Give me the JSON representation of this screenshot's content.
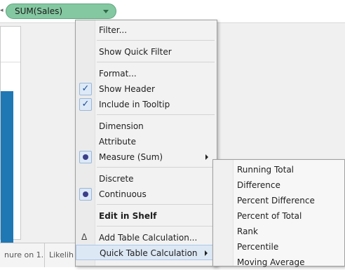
{
  "shelf": {
    "pill_label": "SUM(Sales)",
    "pill_color": "#84c8a1"
  },
  "view": {
    "bar_color": "#1f77b4"
  },
  "tabs": [
    {
      "label": "nure on 1..."
    },
    {
      "label": "Likelih"
    }
  ],
  "context_menu": {
    "items": [
      {
        "label": "Filter..."
      },
      {
        "label": "Show Quick Filter"
      },
      {
        "label": "Format..."
      },
      {
        "label": "Show Header",
        "checked": true
      },
      {
        "label": "Include in Tooltip",
        "checked": true
      },
      {
        "label": "Dimension"
      },
      {
        "label": "Attribute"
      },
      {
        "label": "Measure (Sum)",
        "selected": true,
        "has_submenu": true
      },
      {
        "label": "Discrete"
      },
      {
        "label": "Continuous",
        "selected": true
      },
      {
        "label": "Edit in Shelf"
      },
      {
        "label": "Add Table Calculation...",
        "icon": "delta-icon"
      },
      {
        "label": "Quick Table Calculation",
        "has_submenu": true,
        "highlighted": true
      }
    ],
    "checkmark_glyph": "✓",
    "delta_glyph": "Δ"
  },
  "quick_table_calc_submenu": {
    "items": [
      {
        "label": "Running Total"
      },
      {
        "label": "Difference"
      },
      {
        "label": "Percent Difference"
      },
      {
        "label": "Percent of Total"
      },
      {
        "label": "Rank"
      },
      {
        "label": "Percentile"
      },
      {
        "label": "Moving Average"
      }
    ]
  }
}
